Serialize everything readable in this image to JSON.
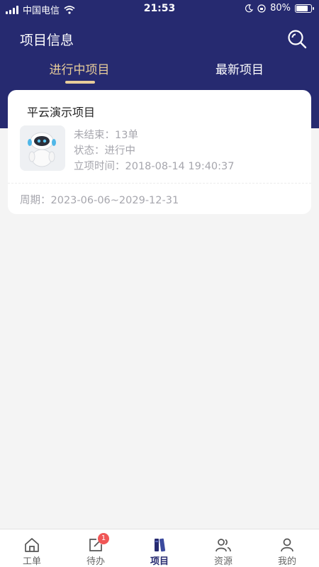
{
  "status_bar": {
    "carrier": "中国电信",
    "time": "21:53",
    "battery_percent": "80%",
    "battery_level": 0.8
  },
  "header": {
    "title": "项目信息",
    "search_icon": "search-icon"
  },
  "tabs": [
    {
      "label": "进行中项目",
      "active": true
    },
    {
      "label": "最新项目",
      "active": false
    }
  ],
  "project": {
    "name": "平云演示项目",
    "unfinished": "未结束：13单",
    "status": "状态：进行中",
    "created": "立项时间：2018-08-14 19:40:37",
    "period": "周期：2023-06-06~2029-12-31"
  },
  "tabbar": {
    "items": [
      {
        "label": "工单",
        "icon": "home-icon",
        "active": false
      },
      {
        "label": "待办",
        "icon": "edit-icon",
        "active": false,
        "badge": "1"
      },
      {
        "label": "项目",
        "icon": "books-icon",
        "active": true
      },
      {
        "label": "资源",
        "icon": "users-icon",
        "active": false
      },
      {
        "label": "我的",
        "icon": "user-icon",
        "active": false
      }
    ]
  },
  "colors": {
    "header_bg": "#262a70",
    "accent": "#e8cd9a",
    "badge": "#f05656"
  }
}
